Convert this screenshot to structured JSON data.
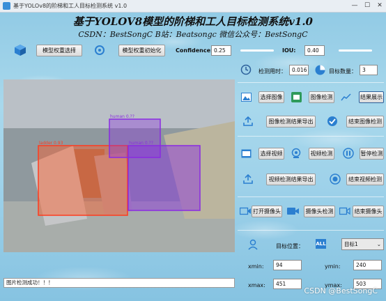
{
  "window": {
    "title": "基于YOLOv8的阶梯和工人目标检测系统 v1.0",
    "min": "—",
    "max": "☐",
    "close": "✕"
  },
  "header": {
    "title": "基于YOLOV8模型的阶梯和工人目标检测系统v1.0",
    "subtitle": "CSDN：BestSongC   B站：Beatsongc   微信公众号：BestSongC"
  },
  "toolbar": {
    "model_select": "模型权重选择",
    "model_init": "模型权重初始化",
    "confidence_label": "Confidence:",
    "confidence_value": "0.25",
    "iou_label": "IOU:",
    "iou_value": "0.40"
  },
  "stats": {
    "time_label": "检测用时：",
    "time_value": "0.016",
    "count_label": "目标数量：",
    "count_value": "3"
  },
  "image_row": {
    "select": "选择图像",
    "detect": "图像检测",
    "show": "结果展示"
  },
  "image_export_row": {
    "export": "图像检测结果导出",
    "end": "结束图像检测"
  },
  "video_row": {
    "select": "选择视频",
    "detect": "视频检测",
    "pause": "暂停检测"
  },
  "video_export_row": {
    "export": "视频检测结果导出",
    "end": "结束视频检测"
  },
  "camera_row": {
    "open": "打开摄像头",
    "detect": "摄像头检测",
    "end": "结束摄像头"
  },
  "target": {
    "position_label": "目标位置：",
    "all_label": "ALL",
    "select_value": "目标1",
    "xmin_label": "xmin:",
    "xmin_value": "94",
    "ymin_label": "ymin:",
    "ymin_value": "240",
    "xmax_label": "xmax:",
    "xmax_value": "451",
    "ymax_label": "ymax:",
    "ymax_value": "503"
  },
  "detections": [
    {
      "label": "ladder 0.93",
      "color": "#ff3b1f"
    },
    {
      "label": "human 0.??",
      "color": "#8a2be2"
    },
    {
      "label": "human 0.??",
      "color": "#8a2be2"
    }
  ],
  "status_text": "图片检测成功！！！",
  "watermark": "CSDN @BestSongC"
}
